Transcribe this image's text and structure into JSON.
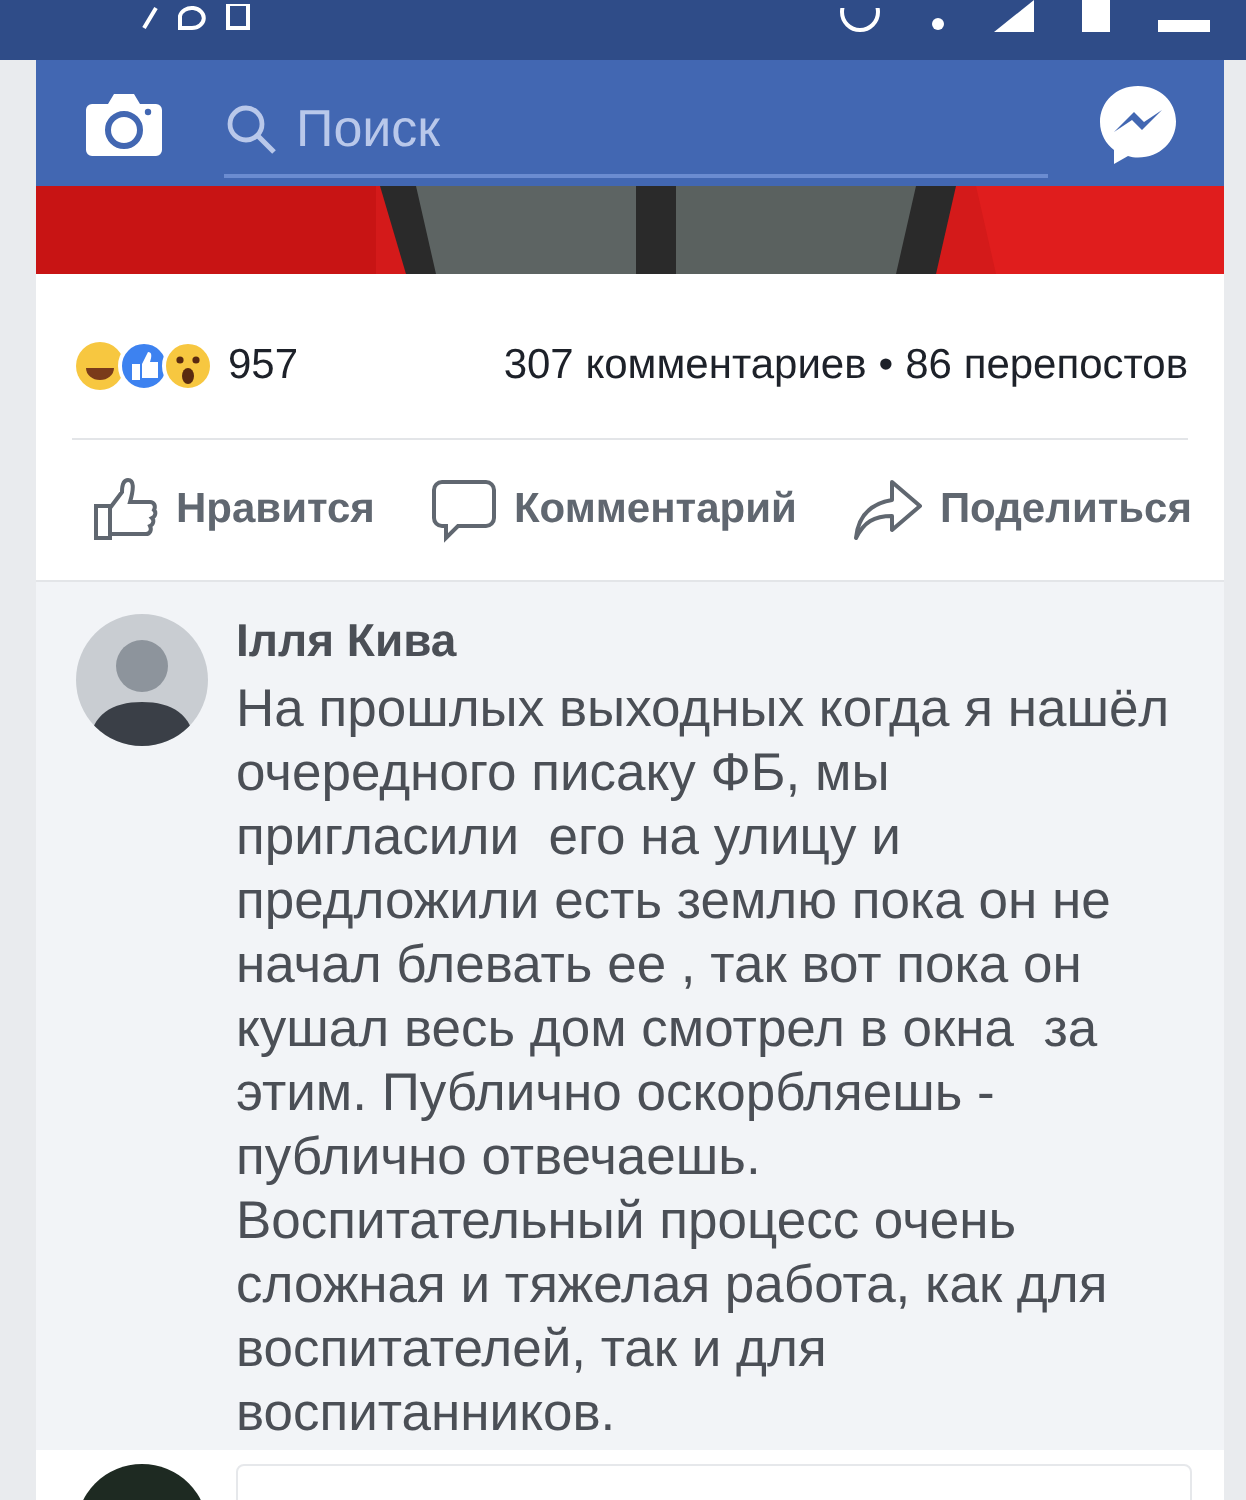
{
  "header": {
    "search": {
      "placeholder": "Поиск"
    }
  },
  "post": {
    "reactions": {
      "count": "957"
    },
    "comments_count": "307 комментариев",
    "separator": "•",
    "shares_count": "86 перепостов",
    "actions": [
      {
        "kind": "like",
        "label": "Нравится"
      },
      {
        "kind": "comment",
        "label": "Комментарий"
      },
      {
        "kind": "share",
        "label": "Поделиться"
      }
    ]
  },
  "comment": {
    "author": "Ілля Кива",
    "text": "На прошлых выходных когда я нашёл очередного писаку ФБ, мы пригласили  его на улицу и предложили есть землю пока он не начал блевать ее , так вот пока он кушал весь дом смотрел в окна  за этим. Публично оскорбляешь - публично отвечаешь. Воспитательный процесс очень сложная и тяжелая работа, как для воспитателей, так и для воспитанников."
  }
}
